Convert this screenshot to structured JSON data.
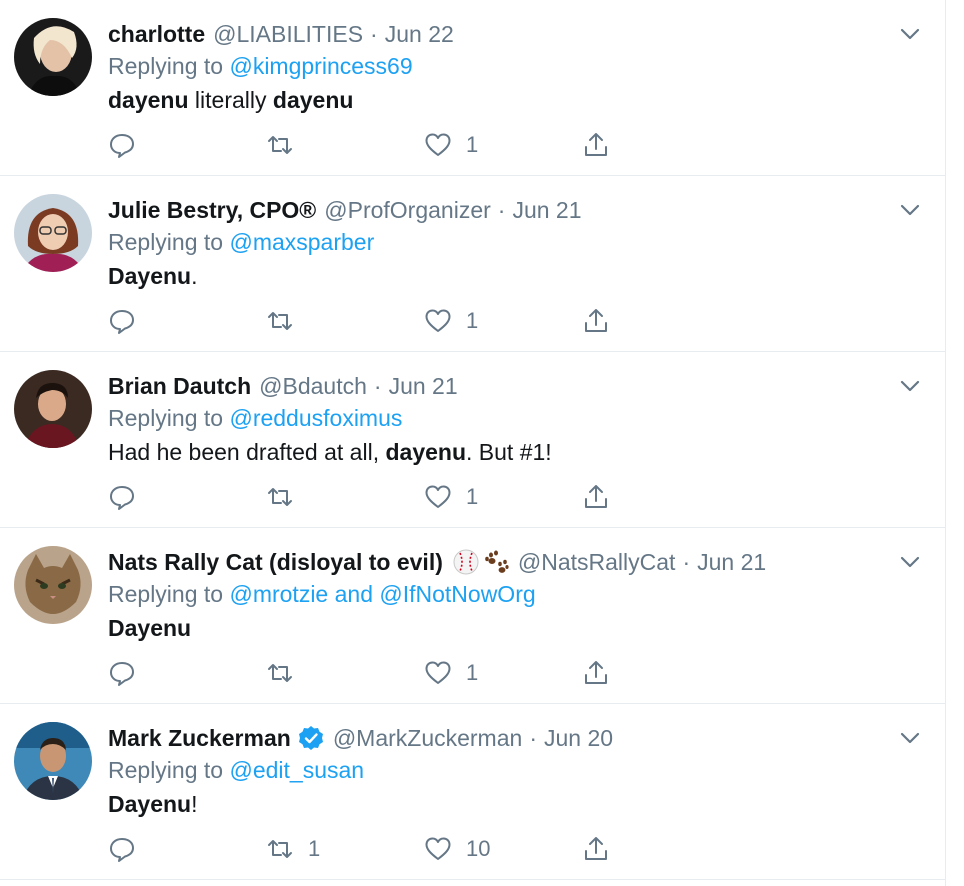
{
  "tweets": [
    {
      "name": "charlotte",
      "handle": "@LIABILITIES",
      "date": "Jun 22",
      "replying_prefix": "Replying to",
      "replying_to": "@kimgprincess69",
      "text": [
        {
          "t": "dayenu",
          "b": true
        },
        {
          "t": " literally ",
          "b": false
        },
        {
          "t": "dayenu",
          "b": true
        }
      ],
      "replies": "",
      "retweets": "",
      "likes": "1"
    },
    {
      "name": "Julie Bestry, CPO®",
      "handle": "@ProfOrganizer",
      "date": "Jun 21",
      "replying_prefix": "Replying to",
      "replying_to": "@maxsparber",
      "text": [
        {
          "t": "Dayenu",
          "b": true
        },
        {
          "t": ".",
          "b": false
        }
      ],
      "replies": "",
      "retweets": "",
      "likes": "1"
    },
    {
      "name": "Brian Dautch",
      "handle": "@Bdautch",
      "date": "Jun 21",
      "replying_prefix": "Replying to",
      "replying_to": "@reddusfoximus",
      "text": [
        {
          "t": "Had he been drafted at all, ",
          "b": false
        },
        {
          "t": "dayenu",
          "b": true
        },
        {
          "t": ". But #1!",
          "b": false
        }
      ],
      "replies": "",
      "retweets": "",
      "likes": "1"
    },
    {
      "name": "Nats Rally Cat (disloyal to evil)",
      "name_icons": [
        "baseball-icon",
        "paw-prints-icon"
      ],
      "handle": "@NatsRallyCat",
      "date": "Jun 21",
      "replying_prefix": "Replying to",
      "replying_to": "@mrotzie",
      "replying_join": "and",
      "replying_to_2": "@IfNotNowOrg",
      "text": [
        {
          "t": "Dayenu",
          "b": true
        }
      ],
      "replies": "",
      "retweets": "",
      "likes": "1"
    },
    {
      "name": "Mark Zuckerman",
      "verified": true,
      "handle": "@MarkZuckerman",
      "date": "Jun 20",
      "replying_prefix": "Replying to",
      "replying_to": "@edit_susan",
      "text": [
        {
          "t": "Dayenu",
          "b": true
        },
        {
          "t": "!",
          "b": false
        }
      ],
      "replies": "",
      "retweets": "1",
      "likes": "10"
    }
  ],
  "colors": {
    "text": "#14171a",
    "secondary": "#657786",
    "link": "#1da1f2",
    "divider": "#e6ecf0",
    "verified": "#1da1f2"
  },
  "icons": {
    "reply": "reply-bubble-icon",
    "retweet": "retweet-icon",
    "like": "heart-icon",
    "share": "share-upload-icon",
    "menu": "chevron-down-icon"
  }
}
